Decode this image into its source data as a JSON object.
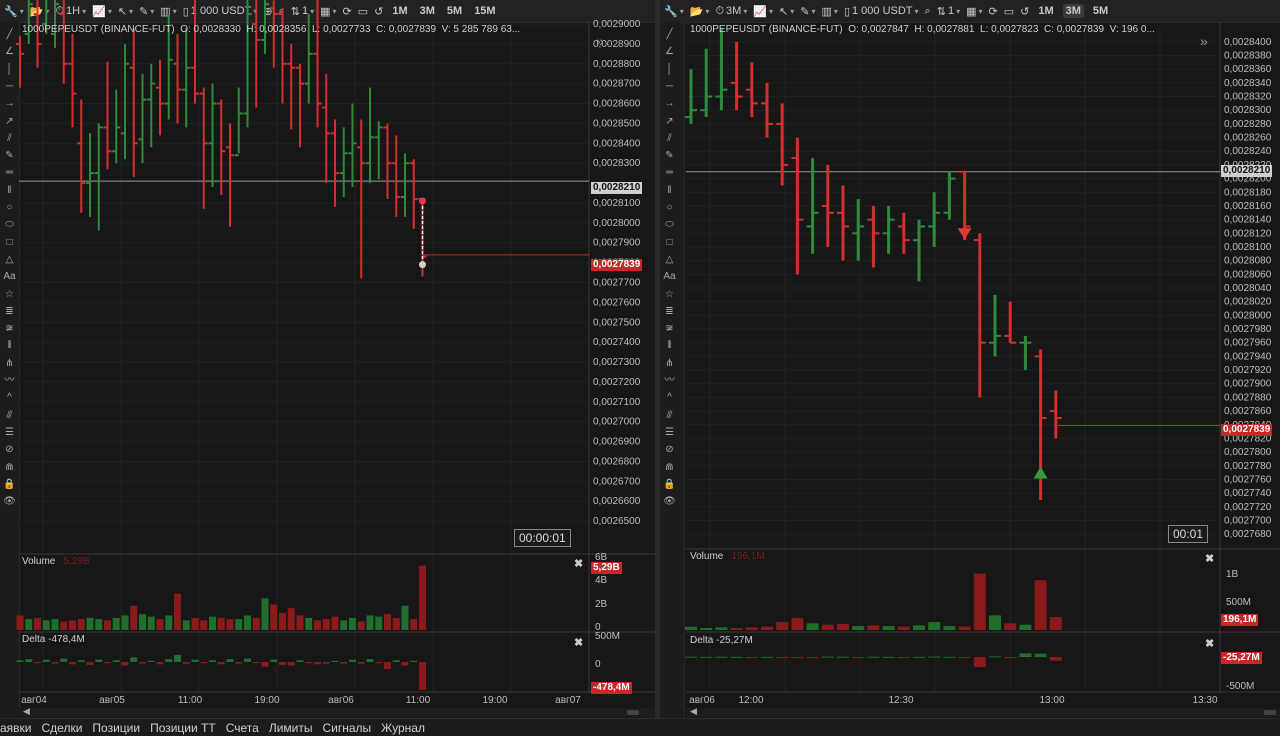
{
  "left": {
    "toolbar": {
      "timeframe": "1H",
      "order_size": "1 000 USDT",
      "order_size_qty": "1",
      "tf_buttons": [
        "1M",
        "3M",
        "5M",
        "15M"
      ],
      "active_tf": ""
    },
    "info": {
      "symbol": "1000PEPEUSDT (BINANCE-FUT)",
      "o": "O: 0,0028330",
      "h": "H: 0,0028356",
      "l": "L: 0,0027733",
      "c": "C: 0,0027839",
      "v": "V: 5 285 789 63..."
    },
    "price_axis": [
      "0,0029000",
      "0,0028900",
      "0,0028800",
      "0,0028700",
      "0,0028600",
      "0,0028500",
      "0,0028400",
      "0,0028300",
      "0,0028100",
      "0,0028000",
      "0,0027900",
      "0,0027800",
      "0,0027700",
      "0,0027600",
      "0,0027500",
      "0,0027400",
      "0,0027300",
      "0,0027200",
      "0,0027100",
      "0,0027000",
      "0,0026900",
      "0,0026800",
      "0,0026700",
      "0,0026600",
      "0,0026500"
    ],
    "hline_label": "0,0028210",
    "last_price_label": "0,0027839",
    "timer": "00:00:01",
    "volume": {
      "title": "Volume",
      "value_dim": "5,29B",
      "axis": [
        "6B",
        "4B",
        "2B",
        "0"
      ],
      "last_label": "5,29B"
    },
    "delta": {
      "title": "Delta -478,4M",
      "axis": [
        "500M",
        "0"
      ],
      "last_label": "-478,4M"
    },
    "time_axis": [
      "авг04",
      "авг05",
      "11:00",
      "19:00",
      "авг06",
      "11:00",
      "19:00",
      "авг07"
    ],
    "chart_data": {
      "type": "ohlc",
      "ylim": [
        0.00264,
        0.0029
      ],
      "hline": 0.002821,
      "last": 0.0027839,
      "bars": [
        [
          0.00289,
          0.002885,
          0.002894,
          0.002868
        ],
        [
          0.002895,
          0.00291,
          0.002918,
          0.00289
        ],
        [
          0.002905,
          0.00289,
          0.00292,
          0.002878
        ],
        [
          0.0029,
          0.002915,
          0.00293,
          0.002895
        ],
        [
          0.002895,
          0.00291,
          0.002925,
          0.002888
        ],
        [
          0.002905,
          0.00288,
          0.00292,
          0.00287
        ],
        [
          0.00288,
          0.002865,
          0.002895,
          0.002848
        ],
        [
          0.00284,
          0.00282,
          0.002862,
          0.002805
        ],
        [
          0.00282,
          0.002825,
          0.002845,
          0.002803
        ],
        [
          0.002825,
          0.002848,
          0.00285,
          0.002796
        ],
        [
          0.002848,
          0.002836,
          0.002881,
          0.002827
        ],
        [
          0.002836,
          0.002848,
          0.002867,
          0.00283
        ],
        [
          0.002845,
          0.00288,
          0.00289,
          0.002832
        ],
        [
          0.002878,
          0.00284,
          0.002898,
          0.002823
        ],
        [
          0.002842,
          0.002862,
          0.002875,
          0.00283
        ],
        [
          0.002862,
          0.00287,
          0.00288,
          0.002838
        ],
        [
          0.002868,
          0.00286,
          0.002882,
          0.002844
        ],
        [
          0.00286,
          0.002882,
          0.002905,
          0.002852
        ],
        [
          0.00288,
          0.002867,
          0.002895,
          0.00285
        ],
        [
          0.002867,
          0.002878,
          0.002898,
          0.002848
        ],
        [
          0.002878,
          0.002865,
          0.002915,
          0.00286
        ],
        [
          0.002865,
          0.00284,
          0.002868,
          0.002807
        ],
        [
          0.00284,
          0.00286,
          0.00287,
          0.002818
        ],
        [
          0.00286,
          0.002836,
          0.002862,
          0.002814
        ],
        [
          0.002838,
          0.002834,
          0.00285,
          0.002798
        ],
        [
          0.002834,
          0.002855,
          0.002868,
          0.002835
        ],
        [
          0.002855,
          0.002905,
          0.002915,
          0.002848
        ],
        [
          0.0029,
          0.002892,
          0.00292,
          0.002858
        ],
        [
          0.002892,
          0.00291,
          0.002918,
          0.002885
        ],
        [
          0.002908,
          0.002905,
          0.002912,
          0.002878
        ],
        [
          0.002905,
          0.00288,
          0.002908,
          0.00286
        ],
        [
          0.00288,
          0.002878,
          0.00289,
          0.002847
        ],
        [
          0.002878,
          0.00287,
          0.00288,
          0.002838
        ],
        [
          0.00287,
          0.002885,
          0.002905,
          0.00286
        ],
        [
          0.002885,
          0.00286,
          0.002925,
          0.002848
        ],
        [
          0.002858,
          0.002845,
          0.002875,
          0.00282
        ],
        [
          0.002845,
          0.002825,
          0.002852,
          0.002808
        ],
        [
          0.002825,
          0.002835,
          0.002848,
          0.002813
        ],
        [
          0.002835,
          0.00284,
          0.00286,
          0.002818
        ],
        [
          0.002838,
          0.00283,
          0.002852,
          0.002772
        ],
        [
          0.00283,
          0.002843,
          0.002868,
          0.00282
        ],
        [
          0.002843,
          0.002848,
          0.002851,
          0.002822
        ],
        [
          0.002848,
          0.00283,
          0.00285,
          0.002812
        ],
        [
          0.00283,
          0.002813,
          0.002844,
          0.002803
        ],
        [
          0.002813,
          0.00283,
          0.002835,
          0.002803
        ],
        [
          0.00283,
          0.002812,
          0.002832,
          0.002797
        ],
        [
          0.002812,
          0.002783,
          0.002812,
          0.002773
        ]
      ],
      "volume": [
        1.2,
        0.9,
        1.0,
        0.8,
        0.9,
        0.7,
        0.8,
        0.9,
        1.0,
        0.9,
        0.8,
        1.0,
        1.2,
        2.0,
        1.3,
        1.1,
        0.9,
        1.2,
        3.0,
        0.8,
        1.0,
        0.8,
        1.1,
        1.0,
        0.9,
        0.9,
        1.2,
        1.0,
        2.6,
        2.1,
        1.4,
        1.8,
        1.2,
        1.0,
        0.8,
        0.9,
        1.1,
        0.8,
        1.0,
        0.7,
        1.2,
        1.1,
        1.3,
        1.0,
        2.0,
        0.9,
        5.29
      ],
      "delta": [
        30,
        50,
        -20,
        40,
        -30,
        60,
        -40,
        30,
        -50,
        40,
        -20,
        30,
        -60,
        80,
        -30,
        20,
        -40,
        50,
        120,
        -30,
        40,
        -20,
        30,
        -40,
        50,
        -30,
        60,
        -20,
        -80,
        40,
        -50,
        -60,
        30,
        -20,
        -40,
        -30,
        20,
        -30,
        40,
        -30,
        50,
        -20,
        -120,
        30,
        -60,
        20,
        -478.4
      ]
    }
  },
  "right": {
    "toolbar": {
      "timeframe": "3M",
      "order_size": "1 000 USDT",
      "order_size_qty": "1",
      "tf_buttons": [
        "1M",
        "3M",
        "5M"
      ],
      "active_tf": "3M"
    },
    "info": {
      "symbol": "1000PEPEUSDT (BINANCE-FUT)",
      "o": "O: 0,0027847",
      "h": "H: 0,0027881",
      "l": "L: 0,0027823",
      "c": "C: 0,0027839",
      "v": "V: 196 0..."
    },
    "price_axis": [
      "0,0028400",
      "0,0028380",
      "0,0028360",
      "0,0028340",
      "0,0028320",
      "0,0028300",
      "0,0028280",
      "0,0028260",
      "0,0028240",
      "0,0028220",
      "0,0028200",
      "0,0028180",
      "0,0028160",
      "0,0028140",
      "0,0028120",
      "0,0028100",
      "0,0028080",
      "0,0028060",
      "0,0028040",
      "0,0028020",
      "0,0028000",
      "0,0027980",
      "0,0027960",
      "0,0027940",
      "0,0027920",
      "0,0027900",
      "0,0027880",
      "0,0027860",
      "0,0027840",
      "0,0027820",
      "0,0027800",
      "0,0027780",
      "0,0027760",
      "0,0027740",
      "0,0027720",
      "0,0027700",
      "0,0027680"
    ],
    "hline_label": "0,0028210",
    "last_price_label": "0,0027839",
    "timer": "00:01",
    "volume": {
      "title": "Volume",
      "value_dim": "196,1M",
      "axis": [
        "1B",
        "500M"
      ],
      "last_label": "196,1M"
    },
    "delta": {
      "title": "Delta -25,27M",
      "axis": [
        "-500M"
      ],
      "last_label": "-25,27M"
    },
    "time_axis": [
      "авг06",
      "12:00",
      "12:30",
      "13:00",
      "13:30"
    ],
    "chart_data": {
      "type": "ohlc",
      "ylim": [
        0.002767,
        0.002841
      ],
      "hline": 0.002821,
      "last": 0.0027839,
      "sell_marker": 0.002812,
      "buy_marker": 0.002777,
      "bars": [
        [
          0.002829,
          0.00283,
          0.002836,
          0.002828
        ],
        [
          0.00283,
          0.002832,
          0.002839,
          0.002829
        ],
        [
          0.002832,
          0.002833,
          0.002842,
          0.00283
        ],
        [
          0.002834,
          0.002832,
          0.00284,
          0.00283
        ],
        [
          0.002833,
          0.002831,
          0.002837,
          0.002829
        ],
        [
          0.002831,
          0.002828,
          0.002834,
          0.002826
        ],
        [
          0.002828,
          0.002822,
          0.002831,
          0.002819
        ],
        [
          0.002823,
          0.002814,
          0.002826,
          0.002806
        ],
        [
          0.002813,
          0.002815,
          0.002823,
          0.002809
        ],
        [
          0.002816,
          0.002815,
          0.002822,
          0.00281
        ],
        [
          0.002815,
          0.002813,
          0.002819,
          0.002808
        ],
        [
          0.002812,
          0.002813,
          0.002817,
          0.002808
        ],
        [
          0.002814,
          0.002812,
          0.002816,
          0.002807
        ],
        [
          0.002812,
          0.002814,
          0.002816,
          0.002809
        ],
        [
          0.002813,
          0.002811,
          0.002815,
          0.002809
        ],
        [
          0.002811,
          0.002813,
          0.002814,
          0.002805
        ],
        [
          0.002813,
          0.002815,
          0.002818,
          0.00281
        ],
        [
          0.002815,
          0.00282,
          0.002821,
          0.002814
        ],
        [
          0.002821,
          0.002813,
          0.002821,
          0.002811
        ],
        [
          0.002811,
          0.002796,
          0.002812,
          0.002788
        ],
        [
          0.002796,
          0.002797,
          0.002803,
          0.002794
        ],
        [
          0.002797,
          0.002796,
          0.002802,
          0.002796
        ],
        [
          0.002796,
          0.002796,
          0.002797,
          0.002792
        ],
        [
          0.002794,
          0.002785,
          0.002795,
          0.002773
        ],
        [
          0.002786,
          0.002785,
          0.002789,
          0.002782
        ]
      ],
      "volume": [
        0.05,
        0.03,
        0.04,
        0.03,
        0.04,
        0.05,
        0.12,
        0.18,
        0.1,
        0.08,
        0.09,
        0.06,
        0.07,
        0.06,
        0.05,
        0.07,
        0.12,
        0.06,
        0.05,
        0.85,
        0.22,
        0.1,
        0.08,
        0.75,
        0.196
      ],
      "delta": [
        2,
        1,
        2,
        1,
        -2,
        1,
        -3,
        -8,
        -5,
        3,
        2,
        -2,
        2,
        1,
        -1,
        1,
        3,
        1,
        -2,
        -70,
        4,
        -5,
        25,
        23,
        -25.27
      ]
    }
  },
  "bottom_tabs": [
    "аявки",
    "Сделки",
    "Позиции",
    "Позиции ТТ",
    "Счета",
    "Лимиты",
    "Сигналы",
    "Журнал"
  ],
  "colors": {
    "up": "#2e8b3a",
    "down": "#d32f2f",
    "vol_up": "#1f6e2b",
    "vol_down": "#8b1a1a",
    "bg": "#171717"
  }
}
